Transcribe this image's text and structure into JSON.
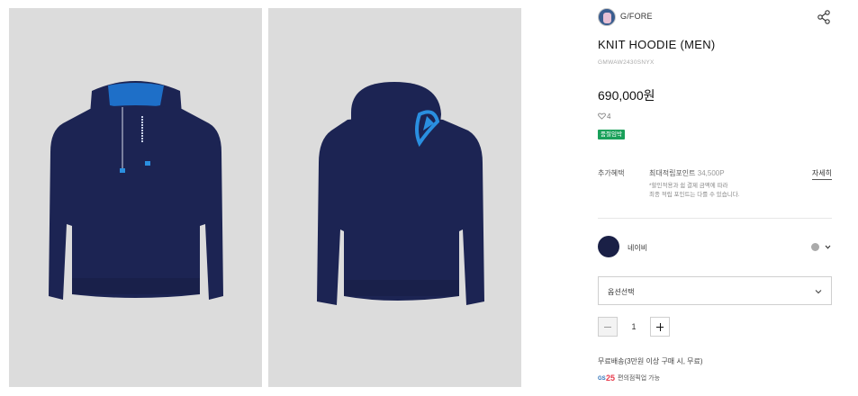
{
  "images": {
    "front_alt": "Knit hoodie front view",
    "back_alt": "Knit hoodie back view"
  },
  "colors": {
    "garment": "#1c2453",
    "hood_lining": "#1e6fc8",
    "accent_blue": "#2a8fe0",
    "photo_bg": "#dcdcdc",
    "badge_green": "#1aa05a",
    "swatch": "#1a2046"
  },
  "brand": {
    "name": "G/FORE",
    "logo_icon": "brand-logo"
  },
  "product": {
    "title": "KNIT HOODIE (MEN)",
    "code": "GMWAW2430SNYX",
    "price": "690,000원",
    "likes": "4",
    "badge": "품절임박"
  },
  "benefit": {
    "label": "추가혜택",
    "point_label": "최대적립포인트",
    "point_value": "34,500P",
    "detail_link": "자세히",
    "note_line1": "*할인적용과 쉼 결제 금액에 따라",
    "note_line2": "최종 적립 포인트는 다를 수 있습니다."
  },
  "color_option": {
    "name": "네이비"
  },
  "option_select": {
    "label": "옵션선택"
  },
  "quantity": {
    "value": "1"
  },
  "shipping": {
    "text": "무료배송(3만원 이상 구매 시, 무료)",
    "pickup_logo": "GS25",
    "pickup_text": "편의점픽업 가능"
  }
}
